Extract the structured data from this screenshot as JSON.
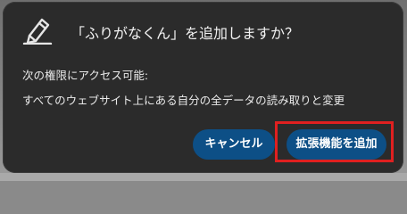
{
  "dialog": {
    "title": "「ふりがなくん」を追加しますか？",
    "subtitle": "次の権限にアクセス可能:",
    "permission": "すべてのウェブサイト上にある自分の全データの読み取りと変更",
    "icon": "pen-icon"
  },
  "buttons": {
    "cancel_label": "キャンセル",
    "add_label": "拡張機能を追加"
  },
  "colors": {
    "dialog_bg": "#2b2b2b",
    "button_bg": "#0d4f86",
    "highlight": "#e02020"
  }
}
